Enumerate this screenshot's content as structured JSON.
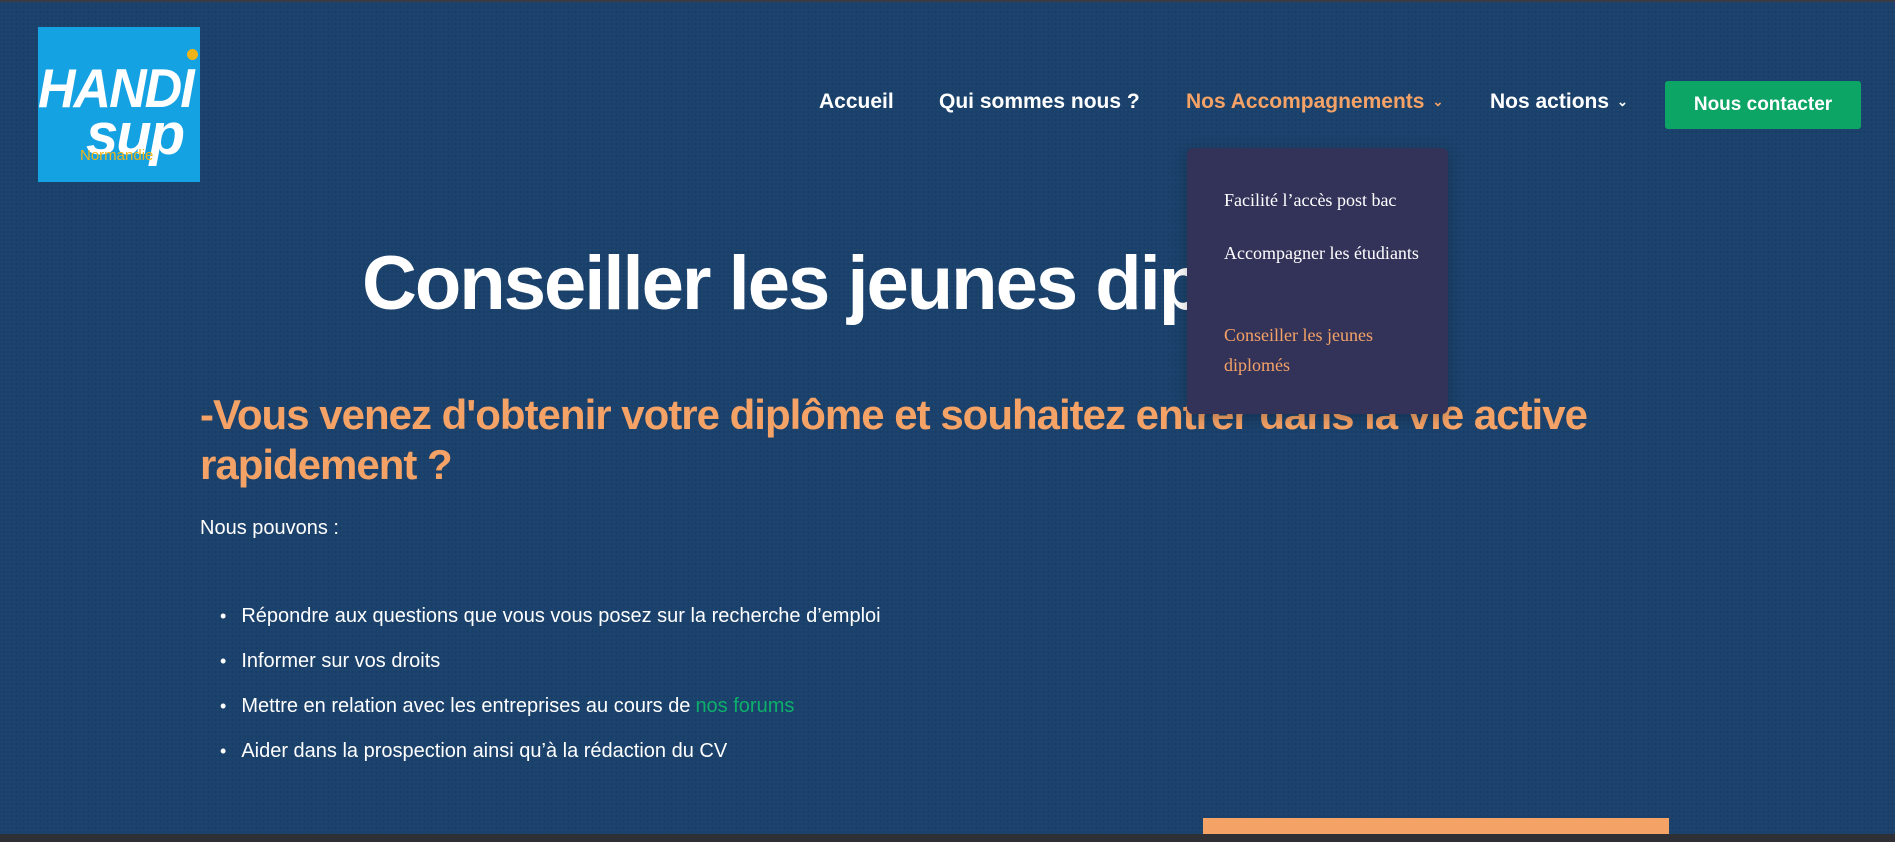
{
  "logo": {
    "line1": "HANDI",
    "line2": "sup",
    "region": "Normandie",
    "colors": {
      "background": "#15a2e3",
      "accent": "#f0b418"
    }
  },
  "nav": {
    "items": [
      {
        "label": "Accueil",
        "has_chevron": false,
        "active": false
      },
      {
        "label": "Qui sommes nous ?",
        "has_chevron": false,
        "active": false
      },
      {
        "label": "Nos Accompagnements",
        "has_chevron": true,
        "active": true
      },
      {
        "label": "Nos actions",
        "has_chevron": true,
        "active": false
      }
    ],
    "cta_label": "Nous contacter",
    "chevron_icon": "chevron-down-icon"
  },
  "dropdown": {
    "items": [
      {
        "label": "Facilité l’accès post bac",
        "current": false
      },
      {
        "label": "Accompagner les étudiants",
        "current": false
      },
      {
        "label": "Conseiller les jeunes diplomés",
        "current": true
      }
    ]
  },
  "main": {
    "title": "Conseiller les jeunes diplomés",
    "subheading": "-Vous venez d'obtenir votre diplôme et souhaitez entrer dans la vie active rapidement ?",
    "intro": "Nous pouvons :",
    "bullets": [
      {
        "text": "Répondre aux questions que vous vous posez sur la recherche d’emploi"
      },
      {
        "text": "Informer sur vos droits"
      },
      {
        "text": "Mettre en relation avec les entreprises au cours de",
        "link": "nos forums"
      },
      {
        "text": "Aider dans la prospection ainsi qu’à la rédaction du CV"
      }
    ]
  },
  "colors": {
    "background": "#1a416b",
    "accent_orange": "#f5a266",
    "accent_green": "#0da565",
    "dropdown_bg": "#33335a"
  }
}
